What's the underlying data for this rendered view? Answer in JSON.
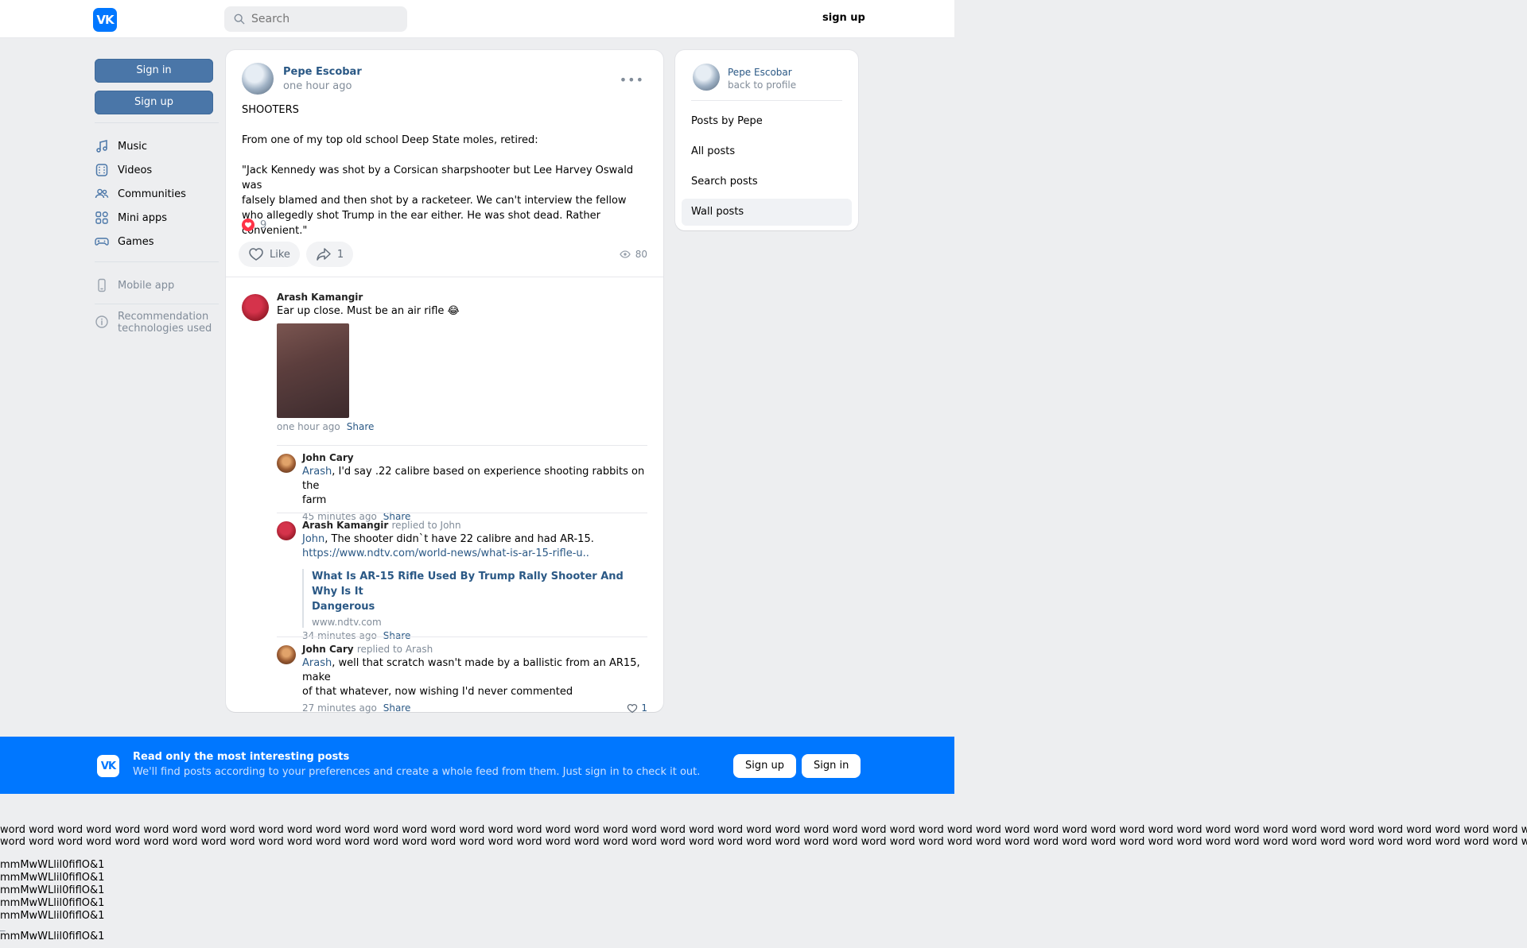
{
  "header": {
    "logo_text": "VK",
    "search_placeholder": "Search",
    "signup_label": "sign up"
  },
  "left_nav": {
    "signin_label": "Sign in",
    "signup_label": "Sign up",
    "items": [
      {
        "label": "Music",
        "icon": "music-icon"
      },
      {
        "label": "Videos",
        "icon": "video-icon"
      },
      {
        "label": "Communities",
        "icon": "communities-icon"
      },
      {
        "label": "Mini apps",
        "icon": "mini-apps-icon"
      },
      {
        "label": "Games",
        "icon": "gamepad-icon"
      }
    ],
    "mobile_app_label": "Mobile app",
    "recommendation_label_1": "Recommendation",
    "recommendation_label_2": "technologies used"
  },
  "post": {
    "author": "Pepe Escobar",
    "time": "one hour ago",
    "title": "SHOOTERS",
    "intro": "From one of my top old school Deep State moles, retired:",
    "quote_line1": "\"Jack Kennedy was shot by a Corsican sharpshooter but Lee Harvey Oswald was",
    "quote_line2": "falsely blamed and then shot by a racketeer. We can't interview the fellow",
    "quote_line3": "who allegedly shot Trump in the ear either. He was shot dead. Rather convenient.\"",
    "reactions_count": "9",
    "like_label": "Like",
    "share_count": "1",
    "views_count": "80"
  },
  "comments": {
    "root": {
      "author": "Arash Kamangir",
      "text": "Ear up close. Must be an air rifle 😂",
      "time": "one hour ago",
      "share_label": "Share"
    },
    "replies": [
      {
        "author": "John Cary",
        "replied_to": "",
        "mention": "Arash",
        "text_line1": ", I'd say .22 calibre based on experience shooting rabbits on the",
        "text_line2": "farm",
        "time": "45 minutes ago",
        "share_label": "Share"
      },
      {
        "author": "Arash Kamangir",
        "replied_to": "replied to John",
        "mention": "John",
        "text_line1": ", The shooter didn`t have 22 calibre and had AR-15.",
        "link": "https://www.ndtv.com/world-news/what-is-ar-15-rifle-u..",
        "snippet_title_line1": "What Is AR-15 Rifle Used By Trump Rally Shooter And Why Is It",
        "snippet_title_line2": "Dangerous",
        "snippet_domain": "www.ndtv.com",
        "time": "34 minutes ago",
        "share_label": "Share"
      },
      {
        "author": "John Cary",
        "replied_to": "replied to Arash",
        "mention": "Arash",
        "text_line1": ", well that scratch wasn't made by a ballistic from an AR15, make",
        "text_line2": "of that whatever, now wishing I'd never commented",
        "time": "27 minutes ago",
        "share_label": "Share",
        "likes": "1"
      }
    ]
  },
  "right_panel": {
    "name": "Pepe Escobar",
    "back_label": "back to profile",
    "items": [
      "Posts by Pepe",
      "All posts",
      "Search posts",
      "Wall posts"
    ]
  },
  "banner": {
    "logo_text": "VK",
    "title": "Read only the most interesting posts",
    "subtitle": "We'll find posts according to your preferences and create a whole feed from them. Just sign in to check it out.",
    "signup_label": "Sign up",
    "signin_label": "Sign in"
  },
  "footer_test": {
    "word_line": "word word word word word word word word word word word word word word word word word word word word word word word word word word word word word word word word word word word word word word word word word word word word word word word word word word word word word word word word word word word word word word word word word word word word word word word word word word word word word word word word word word word word word word word word word word word word word word word word word word word",
    "glyph_line": "mmMwWLlil0fiflO&1"
  },
  "colors": {
    "accent": "#0077ff",
    "link": "#2a5885",
    "button": "#4a76a8",
    "background": "#edeef0"
  }
}
